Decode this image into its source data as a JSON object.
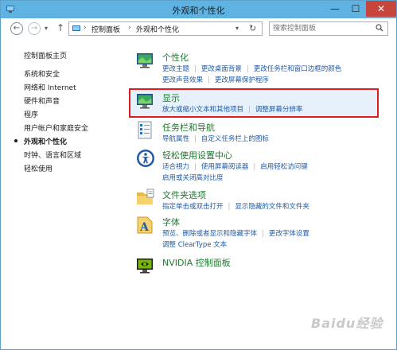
{
  "window": {
    "title": "外观和个性化",
    "close_symbol": "✕",
    "min_symbol": "—",
    "max_symbol": "☐"
  },
  "address": {
    "crumbs": [
      "控制面板",
      "外观和个性化"
    ],
    "search_placeholder": "搜索控制面板"
  },
  "sidebar": {
    "items": [
      {
        "label": "控制面板主页",
        "active": false
      },
      {
        "label": "系统和安全",
        "active": false
      },
      {
        "label": "网络和 Internet",
        "active": false
      },
      {
        "label": "硬件和声音",
        "active": false
      },
      {
        "label": "程序",
        "active": false
      },
      {
        "label": "用户帐户和家庭安全",
        "active": false
      },
      {
        "label": "外观和个性化",
        "active": true
      },
      {
        "label": "时钟、语言和区域",
        "active": false
      },
      {
        "label": "轻松使用",
        "active": false
      }
    ]
  },
  "categories": [
    {
      "title": "个性化",
      "icon": "personalization-icon",
      "rows": [
        [
          "更改主题",
          "更改桌面背景",
          "更改任务栏和窗口边框的颜色"
        ],
        [
          "更改声音效果",
          "更改屏幕保护程序"
        ]
      ]
    },
    {
      "title": "显示",
      "icon": "display-icon",
      "highlighted": true,
      "rows": [
        [
          "放大或缩小文本和其他项目",
          "调整屏幕分辨率"
        ]
      ]
    },
    {
      "title": "任务栏和导航",
      "icon": "taskbar-icon",
      "rows": [
        [
          "导航属性",
          "自定义任务栏上的图标"
        ]
      ]
    },
    {
      "title": "轻松使用设置中心",
      "icon": "ease-of-access-icon",
      "rows": [
        [
          "适合視力",
          "使用屏幕阅读器",
          "启用轻松访问键"
        ],
        [
          "启用或关闭高对比度"
        ]
      ]
    },
    {
      "title": "文件夹选项",
      "icon": "folder-options-icon",
      "rows": [
        [
          "指定单击或双击打开",
          "显示隐藏的文件和文件夹"
        ]
      ]
    },
    {
      "title": "字体",
      "icon": "fonts-icon",
      "rows": [
        [
          "预览、删除或者显示和隐藏字体",
          "更改字体设置"
        ],
        [
          "调整 ClearType 文本"
        ]
      ]
    },
    {
      "title": "NVIDIA 控制面板",
      "icon": "nvidia-icon",
      "rows": []
    }
  ],
  "watermark": "Baidu经验",
  "colors": {
    "accent": "#5fb3e3",
    "link": "#1e5aa8",
    "category_title": "#1e7a2e",
    "highlight_border": "#e11b22"
  }
}
